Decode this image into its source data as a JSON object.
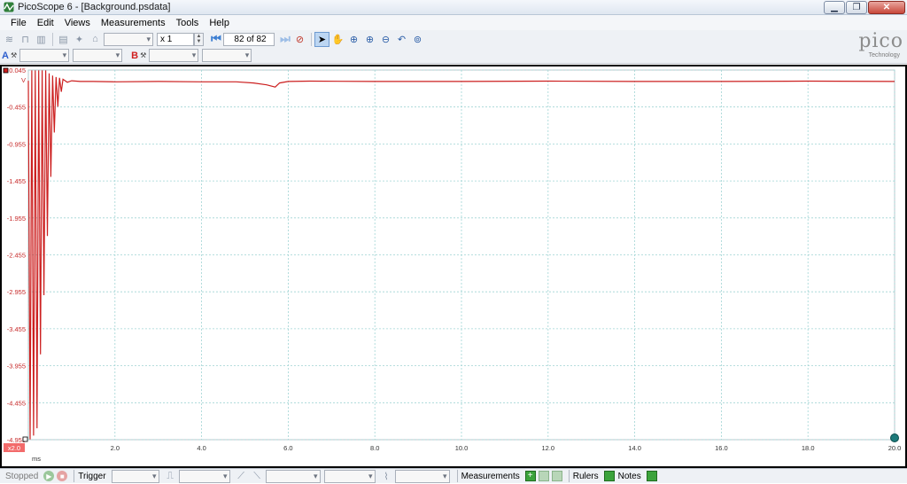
{
  "window": {
    "title": "PicoScope 6 - [Background.psdata]",
    "minimize_glyph": "▁",
    "restore_glyph": "❐",
    "close_glyph": "✕"
  },
  "menu": [
    {
      "label": "File"
    },
    {
      "label": "Edit"
    },
    {
      "label": "Views"
    },
    {
      "label": "Measurements"
    },
    {
      "label": "Tools"
    },
    {
      "label": "Help"
    }
  ],
  "toolbar": {
    "zoom_factor": "x 1",
    "buffer_position": "82 of 82"
  },
  "channels": {
    "a_label": "A",
    "b_label": "B"
  },
  "logo": {
    "word": "pico",
    "sub": "Technology"
  },
  "chart_data": {
    "type": "line",
    "y_unit": "V",
    "x_unit": "ms",
    "x_range": [
      0,
      20
    ],
    "y_range": [
      -4.955,
      0.045
    ],
    "y_ticks": [
      "0.045",
      "-0.455",
      "-0.955",
      "-1.455",
      "-1.955",
      "-2.455",
      "-2.955",
      "-3.455",
      "-3.955",
      "-4.455",
      "-4.955"
    ],
    "y_tick_values": [
      0.045,
      -0.455,
      -0.955,
      -1.455,
      -1.955,
      -2.455,
      -2.955,
      -3.455,
      -3.955,
      -4.455,
      -4.955
    ],
    "x_ticks": [
      "0.0",
      "2.0",
      "4.0",
      "6.0",
      "8.0",
      "10.0",
      "12.0",
      "14.0",
      "16.0",
      "18.0",
      "20.0"
    ],
    "x_tick_values": [
      0,
      2,
      4,
      6,
      8,
      10,
      12,
      14,
      16,
      18,
      20
    ],
    "grid": true,
    "series_color": "#cc1f1f",
    "x_offset_label": "x2.0",
    "series": [
      {
        "x": [
          0.0,
          0.04,
          0.08,
          0.12,
          0.16,
          0.2,
          0.24,
          0.28,
          0.32,
          0.36,
          0.4,
          0.44,
          0.48,
          0.52,
          0.56,
          0.6,
          0.64,
          0.68,
          0.72,
          0.76,
          0.8,
          0.9,
          1.0,
          1.2,
          1.5,
          2.0,
          3.0,
          4.0,
          4.8,
          5.2,
          5.5,
          5.7,
          5.8,
          6.0,
          6.5,
          8.0,
          10.0,
          12.0,
          14.0,
          16.0,
          18.0,
          20.0
        ],
        "y": [
          -0.1,
          -4.95,
          0.04,
          -4.9,
          0.04,
          -4.8,
          0.04,
          -3.8,
          0.04,
          -3.0,
          0.04,
          -2.2,
          0.0,
          -1.4,
          -0.03,
          -0.8,
          -0.05,
          -0.45,
          -0.06,
          -0.25,
          -0.08,
          -0.12,
          -0.1,
          -0.11,
          -0.11,
          -0.115,
          -0.11,
          -0.115,
          -0.115,
          -0.13,
          -0.155,
          -0.185,
          -0.13,
          -0.11,
          -0.105,
          -0.11,
          -0.11,
          -0.105,
          -0.11,
          -0.11,
          -0.105,
          -0.11
        ]
      }
    ]
  },
  "status": {
    "state": "Stopped",
    "trigger_label": "Trigger",
    "measurements_label": "Measurements",
    "rulers_label": "Rulers",
    "notes_label": "Notes",
    "plus_glyph": "+"
  }
}
